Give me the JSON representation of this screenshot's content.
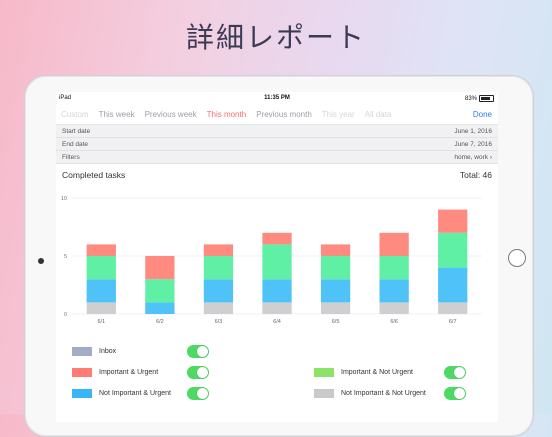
{
  "headline": "詳細レポート",
  "status": {
    "device": "iPad",
    "time": "11:35 PM",
    "battery": "83%"
  },
  "tabs": [
    {
      "label": "Custom",
      "state": "faded"
    },
    {
      "label": "This week",
      "state": "normal"
    },
    {
      "label": "Previous week",
      "state": "normal"
    },
    {
      "label": "This month",
      "state": "active"
    },
    {
      "label": "Previous month",
      "state": "normal"
    },
    {
      "label": "This year",
      "state": "faded"
    },
    {
      "label": "All data",
      "state": "faded"
    }
  ],
  "done_label": "Done",
  "filters": {
    "start_label": "Start date",
    "start_value": "June 1, 2016",
    "end_label": "End date",
    "end_value": "June 7, 2016",
    "filters_label": "Filters",
    "filters_value": "home, work"
  },
  "summary": {
    "title": "Completed tasks",
    "total": "Total: 46"
  },
  "chart_data": {
    "type": "bar",
    "stacked": true,
    "categories": [
      "6/1",
      "6/2",
      "6/3",
      "6/4",
      "6/5",
      "6/6",
      "6/7"
    ],
    "ylim": [
      0,
      10
    ],
    "yticks": [
      0,
      5,
      10
    ],
    "series": [
      {
        "name": "Not Important & Not Urgent",
        "color": "#cfcfd1",
        "values": [
          1,
          0,
          1,
          1,
          1,
          1,
          1
        ]
      },
      {
        "name": "Not Important & Urgent",
        "color": "#4fc3f7",
        "values": [
          2,
          1,
          2,
          2,
          2,
          2,
          3
        ]
      },
      {
        "name": "Important & Not Urgent",
        "color": "#5ff0a5",
        "values": [
          2,
          2,
          2,
          3,
          2,
          2,
          3
        ]
      },
      {
        "name": "Important & Urgent",
        "color": "#ff8a80",
        "values": [
          1,
          2,
          1,
          1,
          1,
          2,
          2
        ]
      }
    ]
  },
  "legend": [
    {
      "label": "Inbox",
      "color": "#a3acc7"
    },
    {
      "label": "Important & Urgent",
      "color": "#ff7b73"
    },
    {
      "label": "Important & Not Urgent",
      "color": "#8de36a"
    },
    {
      "label": "Not Important & Urgent",
      "color": "#37b5f5"
    },
    {
      "label": "Not Important & Not Urgent",
      "color": "#c9c9cb"
    }
  ]
}
